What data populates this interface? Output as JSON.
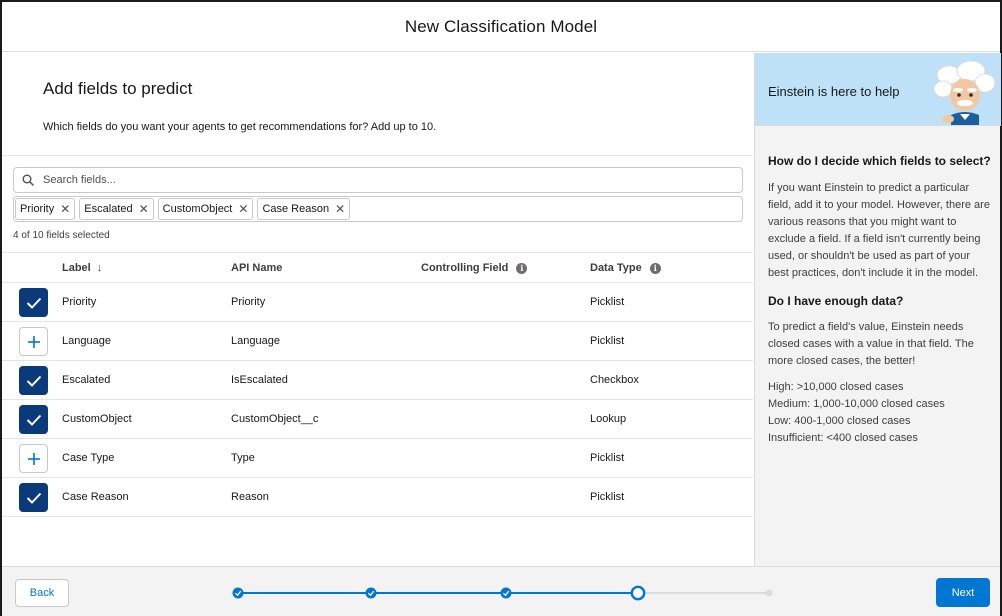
{
  "header": {
    "title": "New Classification Model"
  },
  "main": {
    "title": "Add fields to predict",
    "description": "Which fields do you want your agents to get recommendations for? Add up to 10.",
    "search": {
      "placeholder": "Search fields...",
      "value": ""
    },
    "pills": [
      {
        "label": "Priority"
      },
      {
        "label": "Escalated"
      },
      {
        "label": "CustomObject"
      },
      {
        "label": "Case Reason"
      }
    ],
    "selected_count": "4 of 10 fields selected",
    "columns": {
      "label": "Label",
      "api_name": "API Name",
      "controlling_field": "Controlling Field",
      "data_type": "Data Type"
    },
    "rows": [
      {
        "selected": true,
        "label": "Priority",
        "api_name": "Priority",
        "controlling_field": "",
        "data_type": "Picklist"
      },
      {
        "selected": false,
        "label": "Language",
        "api_name": "Language",
        "controlling_field": "",
        "data_type": "Picklist"
      },
      {
        "selected": true,
        "label": "Escalated",
        "api_name": "IsEscalated",
        "controlling_field": "",
        "data_type": "Checkbox"
      },
      {
        "selected": true,
        "label": "CustomObject",
        "api_name": "CustomObject__c",
        "controlling_field": "",
        "data_type": "Lookup"
      },
      {
        "selected": false,
        "label": "Case Type",
        "api_name": "Type",
        "controlling_field": "",
        "data_type": "Picklist"
      },
      {
        "selected": true,
        "label": "Case Reason",
        "api_name": "Reason",
        "controlling_field": "",
        "data_type": "Picklist"
      }
    ]
  },
  "sidebar": {
    "banner": "Einstein is here to help",
    "q1": "How do I decide which fields to select?",
    "a1": "If you want Einstein to predict a particular field, add it to your model. However, there are various reasons that you might want to exclude a field. If a field isn't currently being used, or shouldn't be used as part of your best practices, don't include it in the model.",
    "q2": "Do I have enough data?",
    "a2": "To predict a field's value, Einstein needs closed cases with a value in that field. The more closed cases, the better!",
    "levels": [
      "High: >10,000 closed cases",
      "Medium: 1,000-10,000 closed cases",
      "Low: 400-1,000 closed cases",
      "Insufficient: <400 closed cases"
    ]
  },
  "footer": {
    "back_label": "Back",
    "next_label": "Next",
    "progress": {
      "total_steps": 5,
      "current_step": 4
    }
  },
  "colors": {
    "brand": "#0176d3",
    "checkbox": "#0b3a7a",
    "banner": "#bfe1f7"
  }
}
